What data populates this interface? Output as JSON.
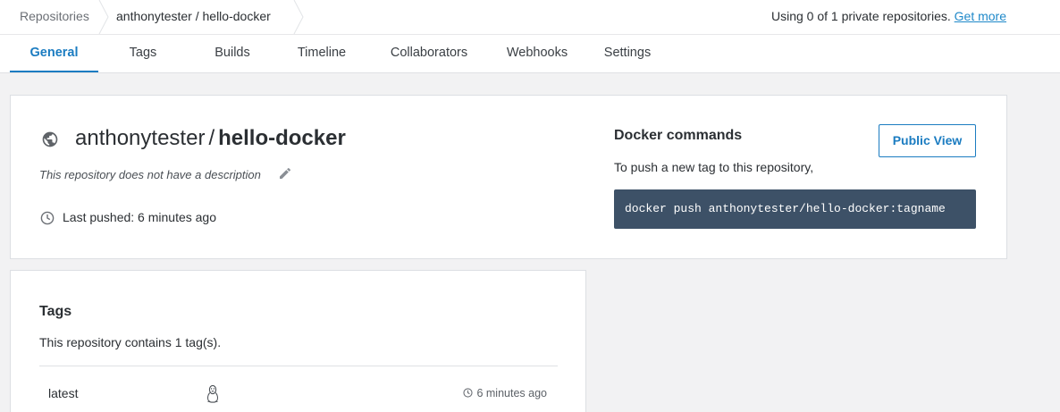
{
  "breadcrumb": {
    "root": "Repositories",
    "repo": "anthonytester / hello-docker"
  },
  "usage": {
    "text": "Using 0 of 1 private repositories.",
    "link": "Get more"
  },
  "tabs": [
    {
      "label": "General",
      "active": true
    },
    {
      "label": "Tags",
      "active": false
    },
    {
      "label": "Builds",
      "active": false
    },
    {
      "label": "Timeline",
      "active": false
    },
    {
      "label": "Collaborators",
      "active": false
    },
    {
      "label": "Webhooks",
      "active": false
    },
    {
      "label": "Settings",
      "active": false
    }
  ],
  "repo": {
    "namespace": "anthonytester",
    "separator": "/",
    "name": "hello-docker",
    "description": "This repository does not have a description",
    "last_pushed": "Last pushed: 6 minutes ago",
    "visibility_icon": "globe-icon"
  },
  "docker_commands": {
    "title": "Docker commands",
    "text": "To push a new tag to this repository,",
    "command": "docker push anthonytester/hello-docker:tagname",
    "public_view_label": "Public View"
  },
  "tags": {
    "title": "Tags",
    "count_text": "This repository contains 1 tag(s).",
    "items": [
      {
        "name": "latest",
        "os_icon": "linux-icon",
        "time": "6 minutes ago"
      }
    ]
  },
  "colors": {
    "accent": "#1b7cc1",
    "link": "#1e88c9",
    "command_bg": "#3d5167",
    "page_bg": "#f2f2f3"
  }
}
